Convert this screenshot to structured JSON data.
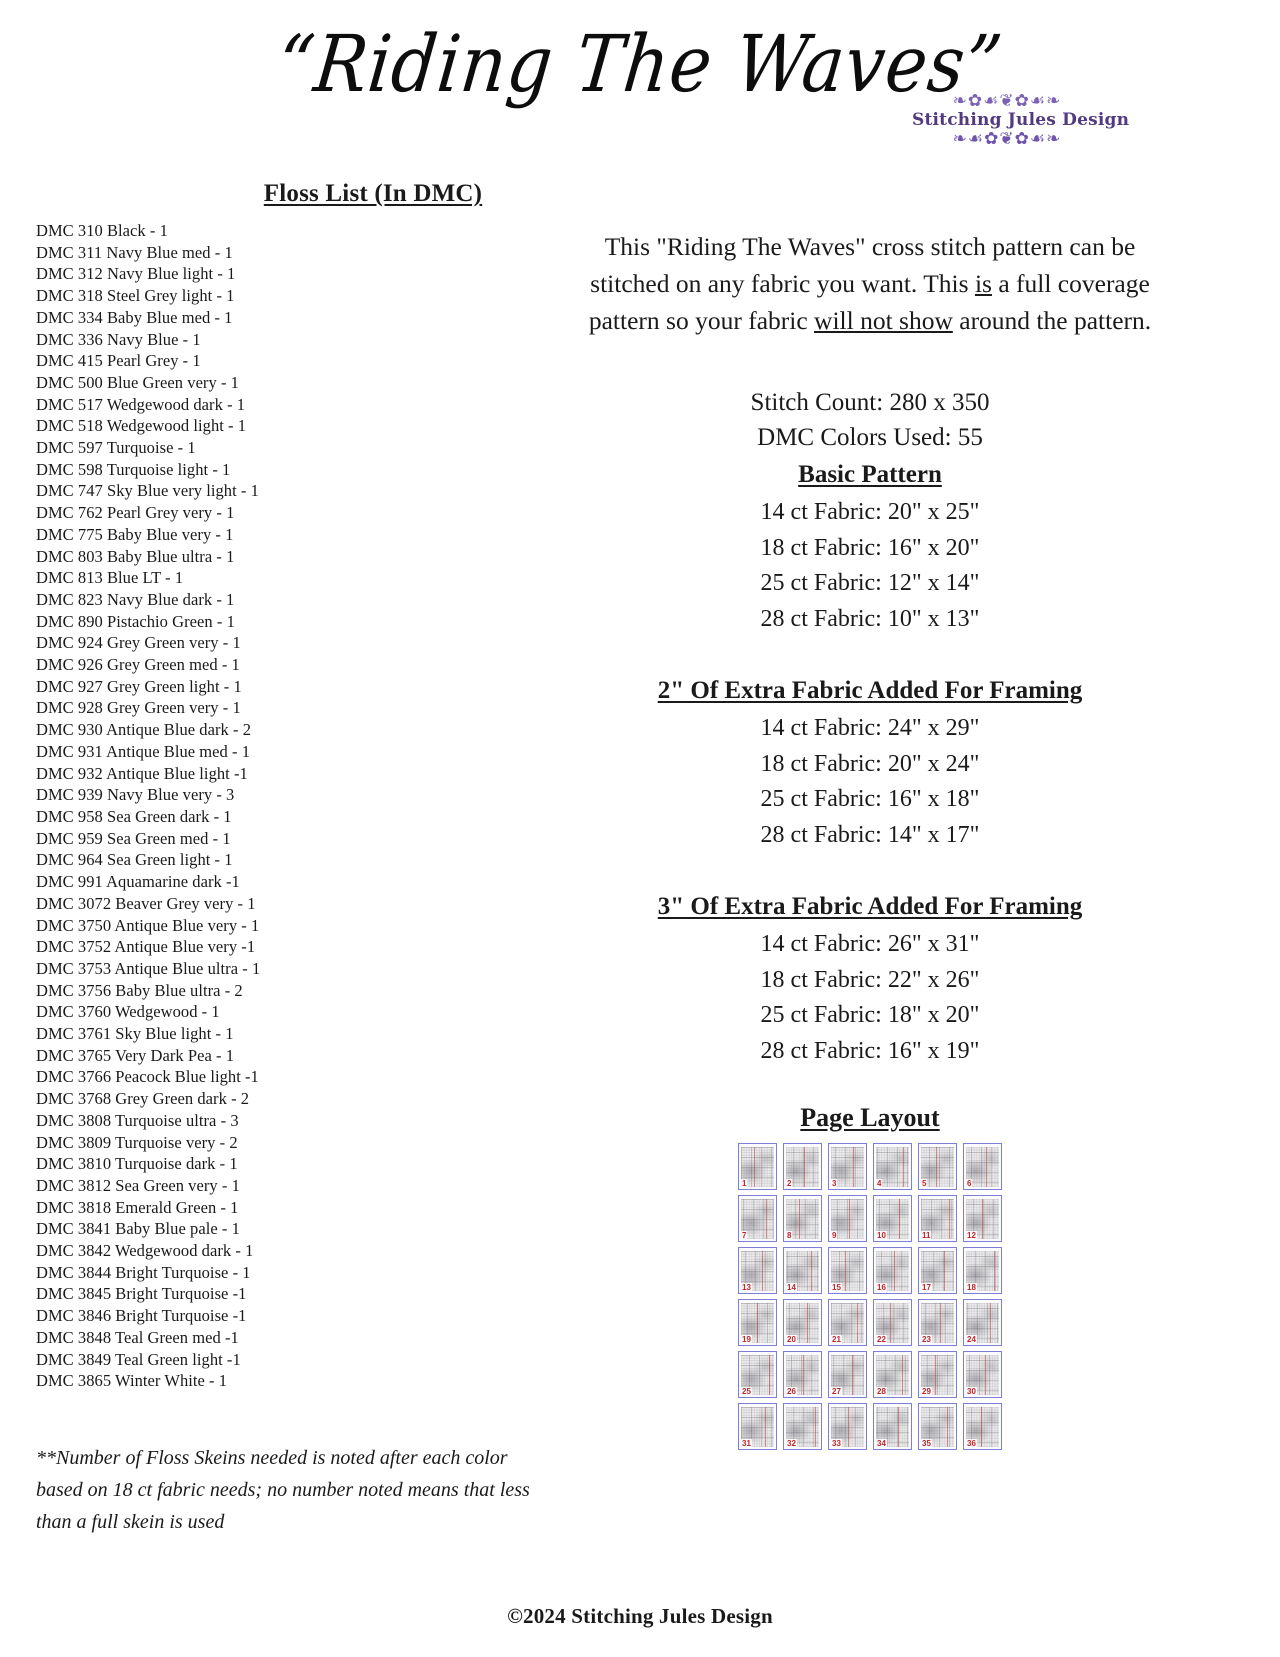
{
  "header": {
    "title": "“Riding The Waves”",
    "logo": {
      "name": "Stitching Jules Design",
      "flourish_top": "❧✿☙❦✿☙❧",
      "flourish_bottom": "❧☙✿❦✿☙❧",
      "color": "#513a80"
    }
  },
  "floss": {
    "heading": "Floss List (In DMC)",
    "items": [
      "DMC 310 Black - 1",
      "DMC 311 Navy Blue med - 1",
      "DMC 312 Navy Blue light - 1",
      "DMC 318 Steel Grey light - 1",
      "DMC 334 Baby Blue med - 1",
      "DMC 336 Navy Blue - 1",
      "DMC 415 Pearl Grey - 1",
      "DMC 500 Blue Green very - 1",
      "DMC 517 Wedgewood dark - 1",
      "DMC 518 Wedgewood light - 1",
      "DMC 597 Turquoise - 1",
      "DMC 598 Turquoise light - 1",
      "DMC 747 Sky Blue very light - 1",
      "DMC 762 Pearl Grey very - 1",
      "DMC 775 Baby Blue very - 1",
      "DMC 803 Baby Blue ultra - 1",
      "DMC 813 Blue LT - 1",
      "DMC 823 Navy Blue dark - 1",
      "DMC 890 Pistachio Green - 1",
      "DMC 924 Grey Green very - 1",
      "DMC 926 Grey Green med - 1",
      "DMC 927 Grey Green light - 1",
      "DMC 928 Grey Green very - 1",
      "DMC 930 Antique Blue dark - 2",
      "DMC 931 Antique Blue med - 1",
      "DMC 932 Antique Blue light -1",
      "DMC 939 Navy Blue very - 3",
      "DMC 958 Sea Green dark - 1",
      "DMC 959 Sea Green med - 1",
      "DMC 964 Sea Green light - 1",
      "DMC 991 Aquamarine dark -1",
      "DMC 3072 Beaver Grey very - 1",
      "DMC 3750 Antique Blue very - 1",
      "DMC 3752 Antique Blue very -1",
      "DMC 3753 Antique Blue ultra - 1",
      "DMC 3756 Baby Blue ultra - 2",
      "DMC 3760 Wedgewood - 1",
      "DMC 3761 Sky Blue light - 1",
      "DMC 3765 Very Dark Pea - 1",
      "DMC 3766 Peacock Blue light -1",
      "DMC 3768 Grey Green dark - 2",
      "DMC 3808 Turquoise ultra - 3",
      "DMC 3809 Turquoise very - 2",
      "DMC 3810 Turquoise dark - 1",
      "DMC 3812 Sea Green very - 1",
      "DMC 3818 Emerald Green - 1",
      "DMC 3841 Baby Blue pale - 1",
      "DMC 3842 Wedgewood dark - 1",
      "DMC 3844 Bright Turquoise - 1",
      "DMC 3845 Bright Turquoise -1",
      "DMC 3846 Bright Turquoise -1",
      "DMC 3848 Teal Green med -1",
      "DMC 3849 Teal Green light -1",
      "DMC 3865 Winter White - 1"
    ],
    "note_line1": "**Number of Floss Skeins needed is noted after each color",
    "note_line2": "based on 18 ct fabric needs; no number noted means that less",
    "note_line3": "than a full skein is used"
  },
  "intro": {
    "part1": "This \"Riding The Waves\" cross stitch pattern can be stitched on any fabric you want. This ",
    "underline1": "is",
    "part2": " a full coverage  pattern  so  your fabric ",
    "underline2": "will not show",
    "part3": " around the pattern."
  },
  "stats": {
    "stitch_count": "Stitch Count:  280 x 350",
    "colors_used": "DMC Colors Used: 55"
  },
  "basic_pattern": {
    "title": "Basic Pattern",
    "sizes": [
      "14 ct Fabric: 20\" x 25\"",
      "18 ct Fabric: 16\" x 20\"",
      "25 ct Fabric: 12\" x 14\"",
      "28 ct Fabric:  10\" x 13\""
    ]
  },
  "framing_2in": {
    "title": "2\" Of Extra Fabric Added For Framing",
    "sizes": [
      "14 ct Fabric:  24\" x 29\"",
      "18 ct Fabric:  20\" x 24\"",
      "25 ct Fabric:  16\" x 18\"",
      "28 ct Fabric:  14\" x 17\""
    ]
  },
  "framing_3in": {
    "title": "3\" Of Extra Fabric Added For Framing",
    "sizes": [
      "14 ct Fabric:  26\" x 31\"",
      "18 ct Fabric:  22\" x 26\"",
      "25 ct Fabric:  18\" x 20\"",
      "28 ct Fabric:  16\" x 19\""
    ]
  },
  "page_layout": {
    "title": "Page Layout",
    "columns": 6,
    "rows": 6,
    "page_numbers": [
      1,
      2,
      3,
      4,
      5,
      6,
      7,
      8,
      9,
      10,
      11,
      12,
      13,
      14,
      15,
      16,
      17,
      18,
      19,
      20,
      21,
      22,
      23,
      24,
      25,
      26,
      27,
      28,
      29,
      30,
      31,
      32,
      33,
      34,
      35,
      36
    ],
    "border_color": "#7e7ed6",
    "number_color": "#c0262b"
  },
  "footer": {
    "copyright": "©2024 Stitching Jules Design"
  }
}
